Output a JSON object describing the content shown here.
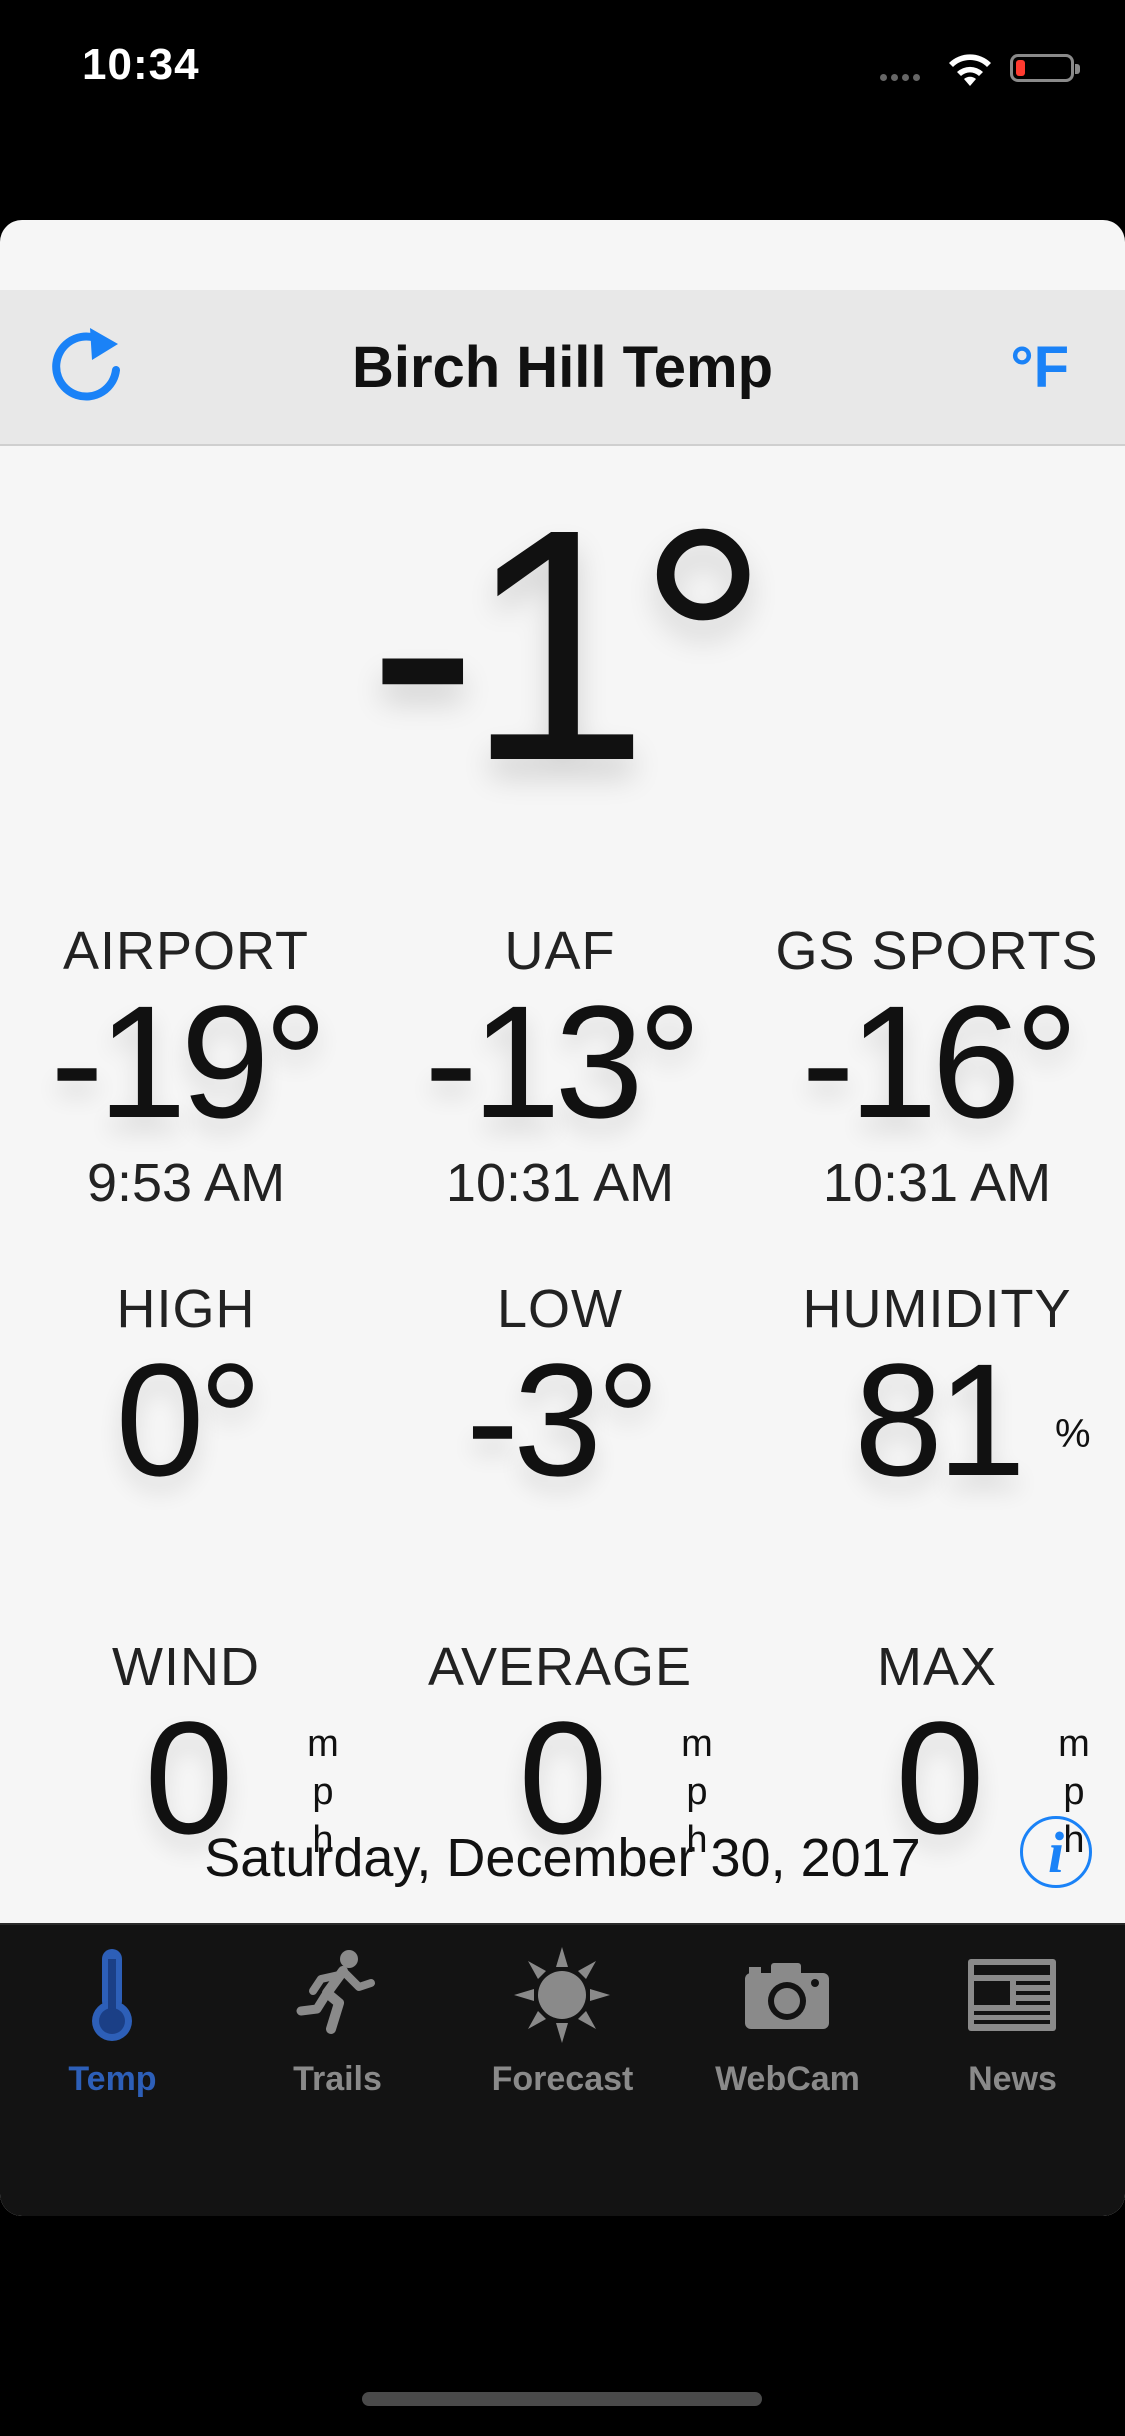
{
  "status_bar": {
    "time": "10:34"
  },
  "navbar": {
    "title": "Birch Hill Temp",
    "unit_button": "°F"
  },
  "current": {
    "temperature": "-1°"
  },
  "stations": [
    {
      "label": "AIRPORT",
      "value": "-19°",
      "time": "9:53 AM"
    },
    {
      "label": "UAF",
      "value": "-13°",
      "time": "10:31 AM"
    },
    {
      "label": "GS SPORTS",
      "value": "-16°",
      "time": "10:31 AM"
    }
  ],
  "stats": [
    {
      "label": "HIGH",
      "value": "0°"
    },
    {
      "label": "LOW",
      "value": "-3°"
    },
    {
      "label": "HUMIDITY",
      "value": "81",
      "unit": "%"
    }
  ],
  "wind": [
    {
      "label": "WIND",
      "value": "0",
      "unit_letters": [
        "m",
        "p",
        "h"
      ]
    },
    {
      "label": "AVERAGE",
      "value": "0",
      "unit_letters": [
        "m",
        "p",
        "h"
      ]
    },
    {
      "label": "MAX",
      "value": "0",
      "unit_letters": [
        "m",
        "p",
        "h"
      ]
    }
  ],
  "date": "Saturday, December 30, 2017",
  "info_button": "i",
  "tabs": [
    {
      "label": "Temp",
      "icon": "thermometer-icon",
      "active": true
    },
    {
      "label": "Trails",
      "icon": "runner-icon",
      "active": false
    },
    {
      "label": "Forecast",
      "icon": "sun-icon",
      "active": false
    },
    {
      "label": "WebCam",
      "icon": "camera-icon",
      "active": false
    },
    {
      "label": "News",
      "icon": "newspaper-icon",
      "active": false
    }
  ],
  "colors": {
    "accent": "#1a82f7",
    "active_tab": "#2d5fb8",
    "inactive_tab": "#8a8a8a",
    "battery_low": "#ff3b30"
  }
}
